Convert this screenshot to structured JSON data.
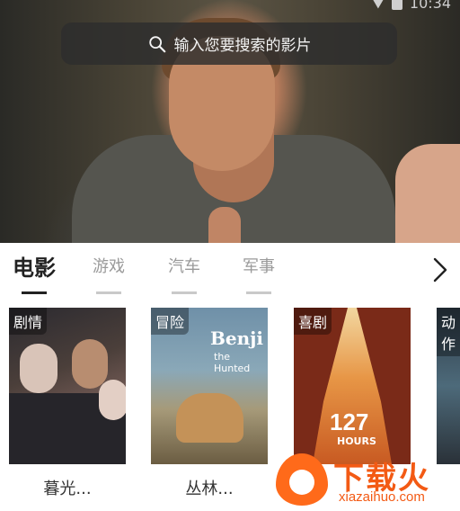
{
  "status_bar": {
    "time": "10:34"
  },
  "search": {
    "placeholder": "输入您要搜索的影片",
    "icon": "search-icon"
  },
  "tabs": [
    {
      "label": "电影",
      "active": true
    },
    {
      "label": "游戏",
      "active": false
    },
    {
      "label": "汽车",
      "active": false
    },
    {
      "label": "军事",
      "active": false
    }
  ],
  "tabs_next_icon": "chevron-right-icon",
  "posters": [
    {
      "tag": "剧情",
      "title": "暮光..."
    },
    {
      "tag": "冒险",
      "title": "丛林...",
      "poster_text": {
        "logo": "Benji",
        "subtitle": "the Hunted"
      }
    },
    {
      "tag": "喜剧",
      "title": "",
      "poster_text": {
        "big": "127",
        "sub": "HOURS"
      }
    },
    {
      "tag": "动作",
      "title": ""
    }
  ],
  "watermark": {
    "brand": "下载火",
    "url": "xiazaihuo.com"
  }
}
